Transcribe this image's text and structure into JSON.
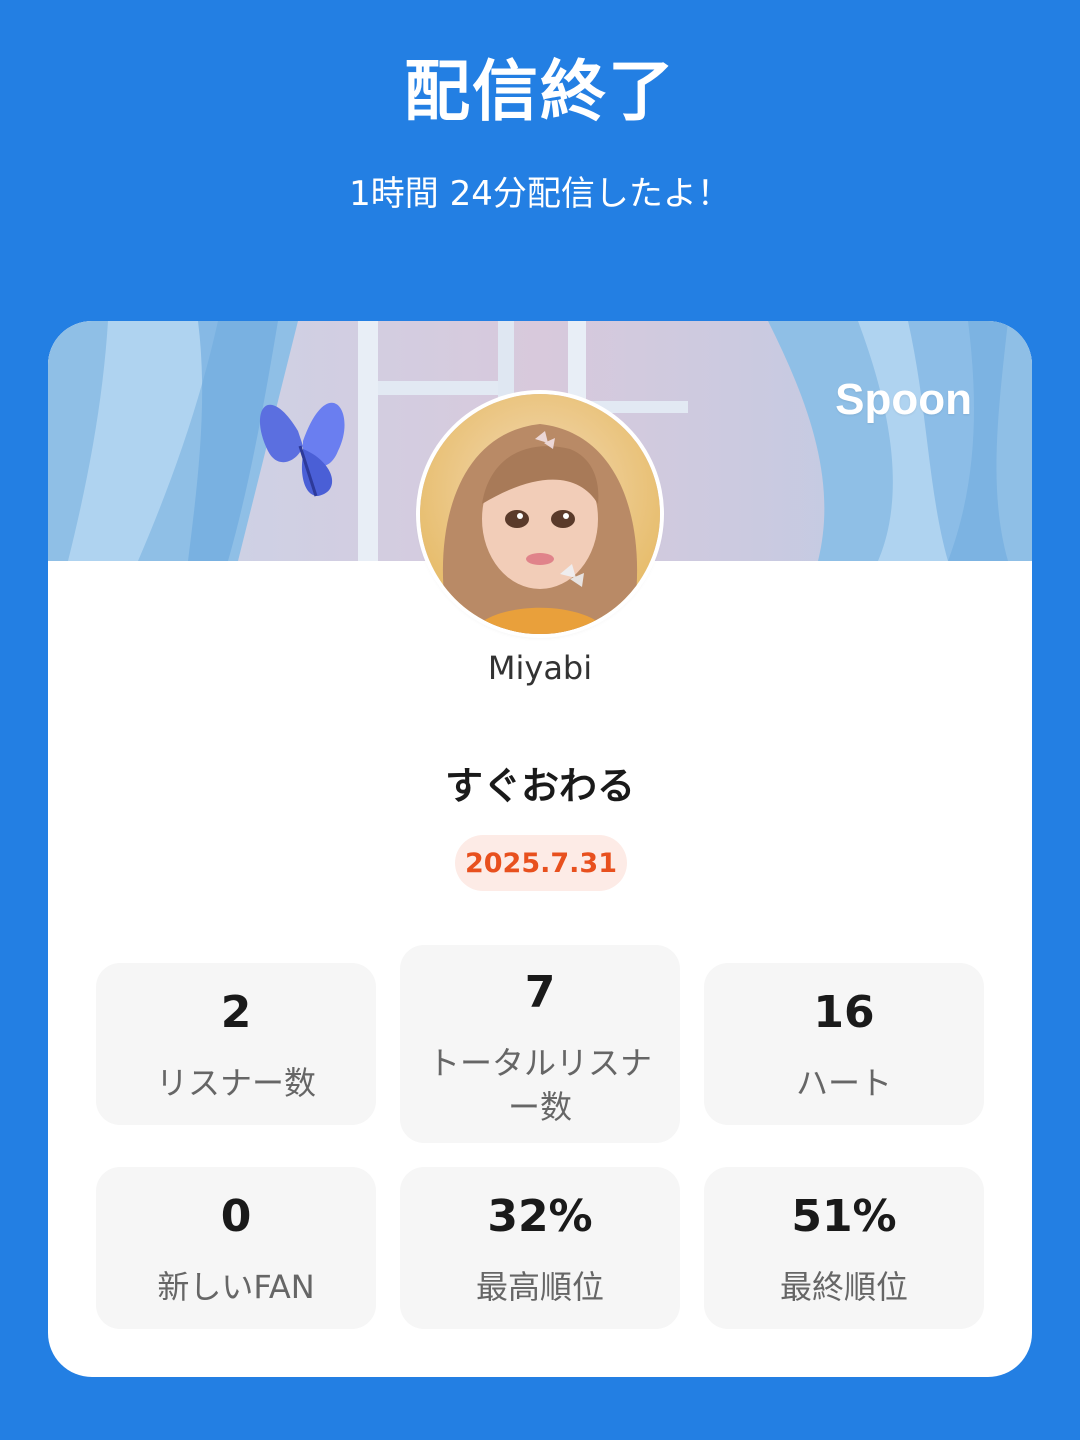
{
  "header": {
    "title": "配信終了",
    "subtitle": "1時間 24分配信したよ！"
  },
  "card": {
    "brand": "Spoon",
    "username": "Miyabi",
    "stream_title": "すぐおわる",
    "date": "2025.7.31",
    "stats": [
      {
        "value": "2",
        "label": "リスナー数"
      },
      {
        "value": "7",
        "label": "トータルリスナ\nー数"
      },
      {
        "value": "16",
        "label": "ハート"
      },
      {
        "value": "0",
        "label": "新しいFAN"
      },
      {
        "value": "32%",
        "label": "最高順位"
      },
      {
        "value": "51%",
        "label": "最終順位"
      }
    ]
  },
  "colors": {
    "background": "#237fe3",
    "card": "#ffffff",
    "stat_tile": "#f6f6f6",
    "date_text": "#e8501e",
    "date_badge": "#fdebe6"
  }
}
